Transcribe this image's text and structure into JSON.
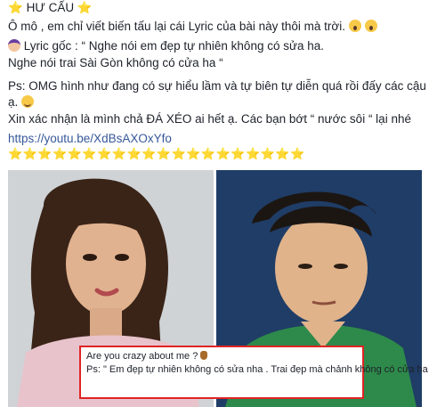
{
  "post": {
    "title": "HƯ CẤU",
    "line1": "Ô mô , em chỉ viết biến tấu lại cái Lyric của bài này thôi mà trời.",
    "lyric_label": "Lyric gốc : “ Nghe nói em đẹp tự nhiên không có sửa ha.",
    "lyric_line2": "Nghe nói trai Sài Gòn không có cửa ha “",
    "ps_line1": "Ps: OMG hình như đang có sự hiểu lầm và tự biên tự diễn quá rồi đấy các cậu",
    "ps_line2": "ạ.",
    "confirm_line": "Xin xác nhận là mình chả ĐÁ XÉO ai hết ạ. Các bạn bớt “ nước sôi “ lại nhé",
    "link_text": "https://youtu.be/XdBsAXOxYfo",
    "stars_row": "⭐⭐⭐⭐⭐⭐⭐⭐⭐⭐⭐⭐⭐⭐⭐⭐⭐⭐⭐⭐"
  },
  "caption": {
    "line1": "Are you crazy about me ?",
    "line2": "Ps: \" Em đẹp tự nhiên không có sửa nha . Trai đẹp mà chảnh không có cửa ha"
  },
  "icons": {
    "star": "star-icon",
    "face_scream": "face-screaming-icon",
    "person": "person-icon",
    "wink": "winking-face-icon",
    "bag": "money-bag-icon"
  }
}
